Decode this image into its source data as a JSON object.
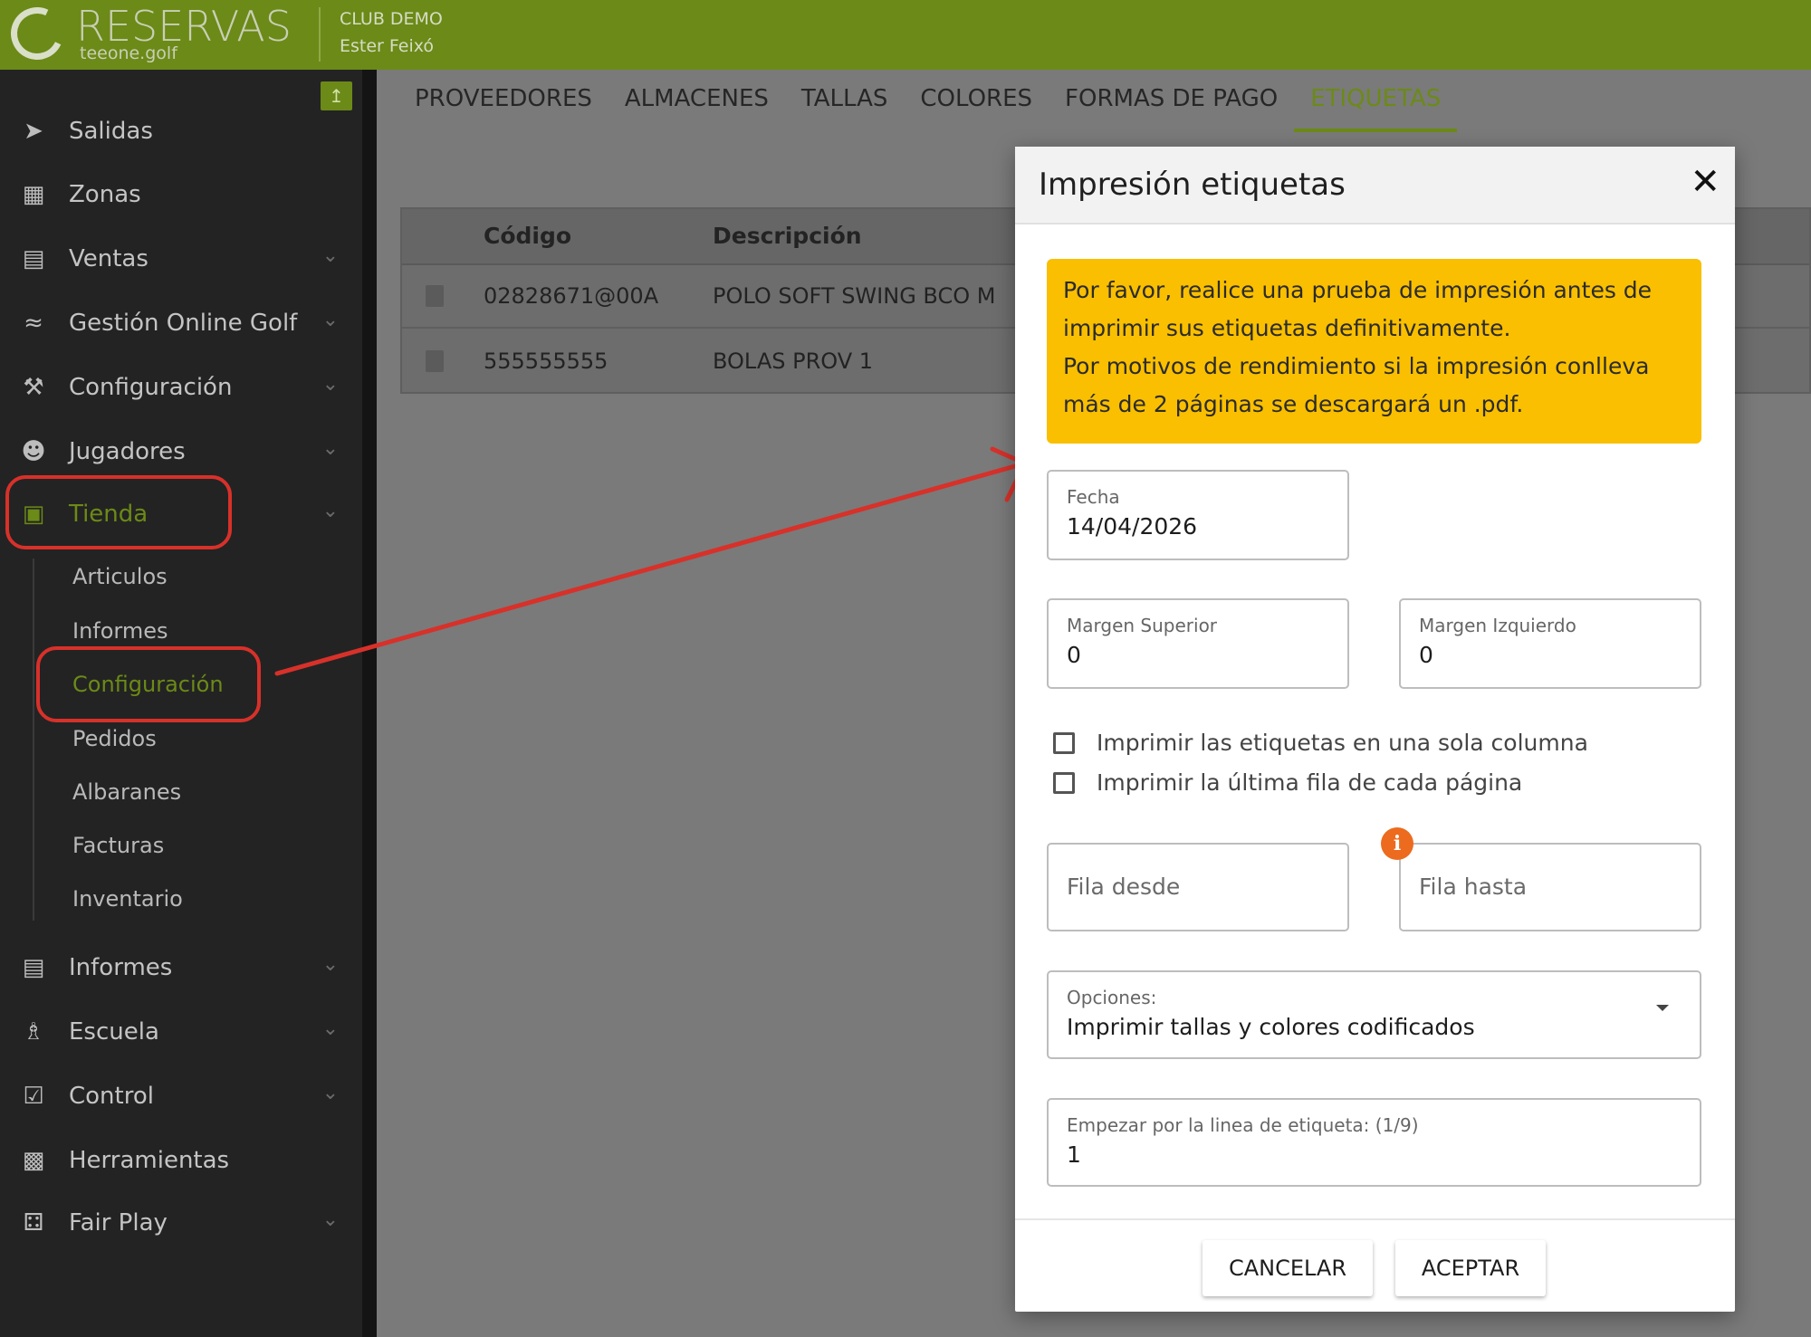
{
  "app": {
    "logo_title": "RESERVAS",
    "logo_subtitle": "teeone.golf",
    "club_name": "CLUB DEMO",
    "user_name": "Ester Feixó",
    "brand_color": "#6c8a17"
  },
  "sidebar": {
    "pin_icon": "pin-icon",
    "items": [
      {
        "label": "Salidas",
        "icon": "send-icon",
        "has_chevron": false
      },
      {
        "label": "Zonas",
        "icon": "map-icon",
        "has_chevron": false
      },
      {
        "label": "Ventas",
        "icon": "card-icon",
        "has_chevron": true
      },
      {
        "label": "Gestión Online Golf",
        "icon": "wifi-icon",
        "has_chevron": true
      },
      {
        "label": "Configuración",
        "icon": "wrench-icon",
        "has_chevron": true
      },
      {
        "label": "Jugadores",
        "icon": "users-icon",
        "has_chevron": true
      },
      {
        "label": "Tienda",
        "icon": "store-icon",
        "has_chevron": true,
        "active": true
      },
      {
        "label": "Informes",
        "icon": "report-icon",
        "has_chevron": true
      },
      {
        "label": "Escuela",
        "icon": "school-icon",
        "has_chevron": true
      },
      {
        "label": "Control",
        "icon": "clipboard-icon",
        "has_chevron": true
      },
      {
        "label": "Herramientas",
        "icon": "toolbox-icon",
        "has_chevron": false
      },
      {
        "label": "Fair Play",
        "icon": "dice-icon",
        "has_chevron": true
      }
    ],
    "tienda_sub": [
      {
        "label": "Articulos"
      },
      {
        "label": "Informes"
      },
      {
        "label": "Configuración",
        "active": true
      },
      {
        "label": "Pedidos"
      },
      {
        "label": "Albaranes"
      },
      {
        "label": "Facturas"
      },
      {
        "label": "Inventario"
      }
    ]
  },
  "main": {
    "tabs": [
      {
        "label": "PROVEEDORES"
      },
      {
        "label": "ALMACENES"
      },
      {
        "label": "TALLAS"
      },
      {
        "label": "COLORES"
      },
      {
        "label": "FORMAS DE PAGO"
      },
      {
        "label": "ETIQUETAS",
        "active": true
      }
    ],
    "table": {
      "headers": [
        "Código",
        "Descripción"
      ],
      "rows": [
        [
          "02828671@00A",
          "POLO SOFT SWING BCO M"
        ],
        [
          "555555555",
          "BOLAS PROV 1"
        ]
      ]
    }
  },
  "modal": {
    "title": "Impresión etiquetas",
    "alert_lines": [
      "Por favor, realice una prueba de impresión antes de",
      "imprimir sus etiquetas definitivamente.",
      "Por motivos de rendimiento si la impresión conlleva",
      "más de 2 páginas se descargará un .pdf."
    ],
    "alert_color": "#f9bf00",
    "fecha": {
      "label": "Fecha",
      "value": "14/04/2026"
    },
    "margen_superior": {
      "label": "Margen Superior",
      "value": "0"
    },
    "margen_izquierdo": {
      "label": "Margen Izquierdo",
      "value": "0"
    },
    "checkboxes": [
      {
        "label": "Imprimir las etiquetas en una sola columna",
        "checked": false
      },
      {
        "label": "Imprimir la última fila de cada página",
        "checked": false
      }
    ],
    "fila_desde": {
      "placeholder": "Fila desde"
    },
    "fila_hasta": {
      "placeholder": "Fila hasta"
    },
    "info_glyph": "i",
    "opciones": {
      "label": "Opciones:",
      "value": "Imprimir tallas y colores codificados"
    },
    "empezar": {
      "label": "Empezar por la linea de etiqueta: (1/9)",
      "value": "1"
    },
    "cancel_label": "CANCELAR",
    "accept_label": "ACEPTAR"
  },
  "annotation_color": "#d7312a"
}
